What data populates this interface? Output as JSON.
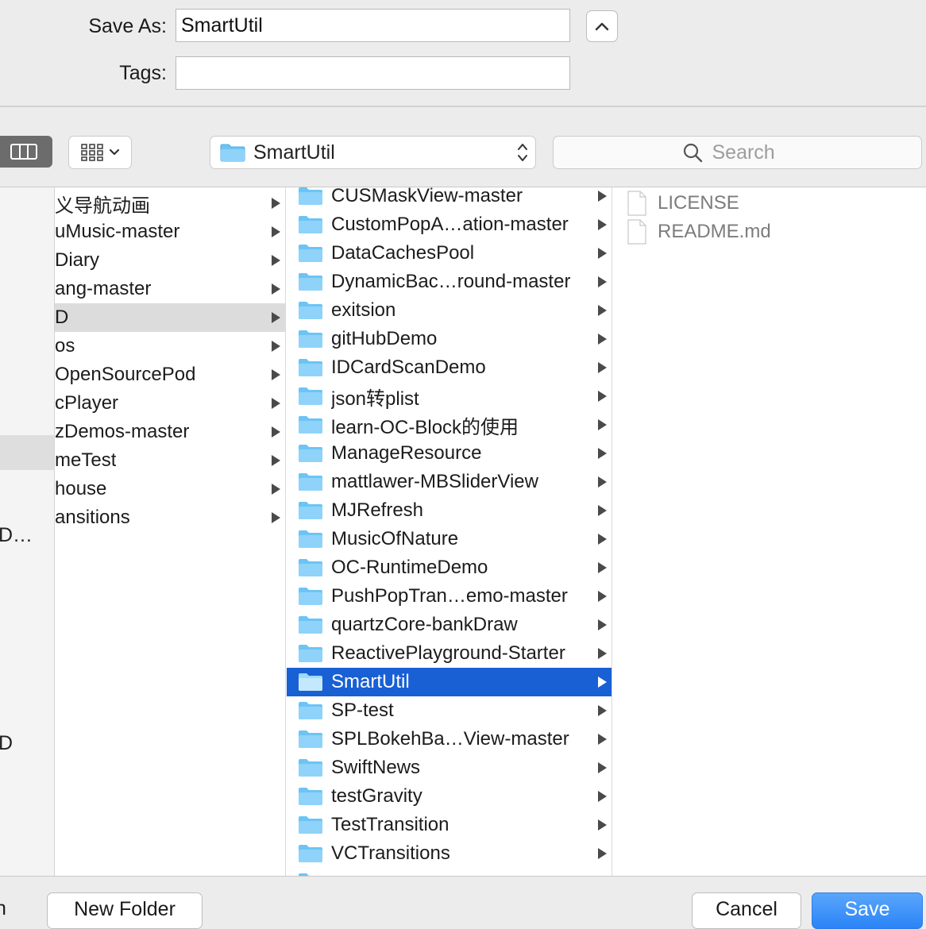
{
  "dialog": {
    "save_as_label": "Save As:",
    "save_as_value": "SmartUtil",
    "tags_label": "Tags:",
    "tags_value": ""
  },
  "toolbar": {
    "path_folder": "SmartUtil",
    "search_placeholder": "Search"
  },
  "sidebar": {
    "fragments": [
      "D…",
      "D"
    ]
  },
  "column1": {
    "items": [
      {
        "label": "义导航动画"
      },
      {
        "label": "uMusic-master"
      },
      {
        "label": "Diary"
      },
      {
        "label": "ang-master"
      },
      {
        "label": "D",
        "selected": true
      },
      {
        "label": "os"
      },
      {
        "label": "OpenSourcePod"
      },
      {
        "label": "cPlayer"
      },
      {
        "label": "zDemos-master"
      },
      {
        "label": "meTest"
      },
      {
        "label": "house"
      },
      {
        "label": "ansitions"
      }
    ]
  },
  "column2": {
    "items": [
      {
        "label": "CUSMaskView-master"
      },
      {
        "label": "CustomPopA…ation-master"
      },
      {
        "label": "DataCachesPool"
      },
      {
        "label": "DynamicBac…round-master"
      },
      {
        "label": "exitsion"
      },
      {
        "label": "gitHubDemo"
      },
      {
        "label": "IDCardScanDemo"
      },
      {
        "label": "json转plist"
      },
      {
        "label": "learn-OC-Block的使用"
      },
      {
        "label": "ManageResource"
      },
      {
        "label": "mattlawer-MBSliderView"
      },
      {
        "label": "MJRefresh"
      },
      {
        "label": "MusicOfNature"
      },
      {
        "label": "OC-RuntimeDemo"
      },
      {
        "label": "PushPopTran…emo-master"
      },
      {
        "label": "quartzCore-bankDraw"
      },
      {
        "label": "ReactivePlayground-Starter"
      },
      {
        "label": "SmartUtil",
        "selected": true
      },
      {
        "label": "SP-test"
      },
      {
        "label": "SPLBokehBa…View-master"
      },
      {
        "label": "SwiftNews"
      },
      {
        "label": "testGravity"
      },
      {
        "label": "TestTransition"
      },
      {
        "label": "VCTransitions"
      }
    ]
  },
  "column3": {
    "items": [
      {
        "label": "LICENSE"
      },
      {
        "label": "README.md"
      }
    ]
  },
  "footer": {
    "left_fragment": "n",
    "new_folder_label": "New Folder",
    "cancel_label": "Cancel",
    "save_label": "Save"
  },
  "colors": {
    "selection": "#1860d4",
    "folder": "#6cc4f5",
    "primary_button": "#2a84f7"
  }
}
